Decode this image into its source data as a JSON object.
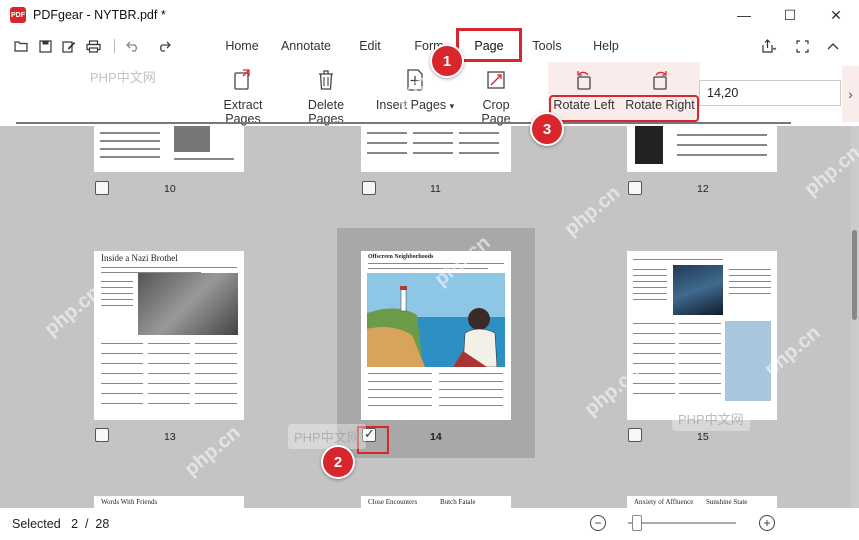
{
  "window": {
    "title": "PDFgear - NYTBR.pdf *",
    "logo_text": "PDF",
    "controls": {
      "minimize": "—",
      "maximize": "☐",
      "close": "✕"
    }
  },
  "quick_access": {
    "icons": [
      "open-folder-icon",
      "save-icon",
      "edit-icon",
      "print-icon",
      "undo-icon",
      "redo-icon"
    ]
  },
  "menu": {
    "items": [
      "Home",
      "Annotate",
      "Edit",
      "Form",
      "Page",
      "Tools",
      "Help"
    ],
    "active": "Page"
  },
  "menu_right": {
    "share_icon": "share-icon",
    "fullscreen_icon": "fullscreen-icon",
    "collapse_icon": "chevron-up-icon"
  },
  "toolbar": {
    "extract_pages": "Extract Pages",
    "delete_pages": "Delete Pages",
    "insert_pages": "Insert Pages",
    "crop_page": "Crop Page",
    "rotate_left": "Rotate Left",
    "rotate_right": "Rotate Right",
    "page_range_value": "14,20",
    "more_arrow": "›"
  },
  "pages": {
    "row1": [
      "10",
      "11",
      "12"
    ],
    "row2": [
      "13",
      "14",
      "15"
    ],
    "selected": "14",
    "thumb_titles": {
      "p13": "Inside a Nazi Brothel",
      "p14": "Offscreen Neighborhoods",
      "row3_left": "Words With Friends",
      "row3_mid_a": "Close Encounters",
      "row3_mid_b": "Butch Fatale",
      "row3_right_a": "Anxiety of Affluence",
      "row3_right_b": "Sunshine State"
    }
  },
  "markers": [
    "1",
    "2",
    "3"
  ],
  "watermark": {
    "cn_label": "PHP中文网",
    "url_text": "php.cn"
  },
  "status": {
    "selected_label": "Selected",
    "selected_count": "2",
    "separator": "/",
    "total": "28"
  },
  "zoom": {
    "minus": "−",
    "plus": "+",
    "level": 0.08
  },
  "colors": {
    "accent_red": "#d9262c",
    "content_bg": "#c4c4c4",
    "selected_frame": "#a8a8a8"
  }
}
